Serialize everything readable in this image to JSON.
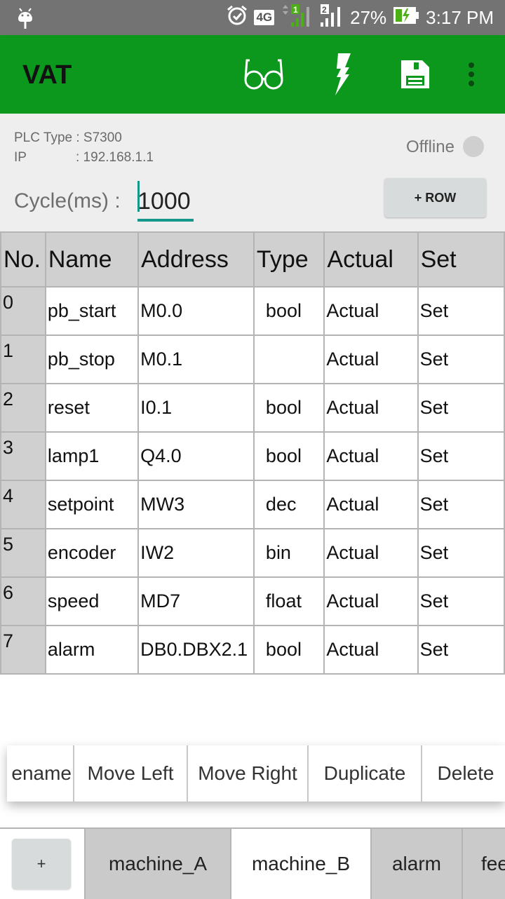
{
  "status_bar": {
    "network": "4G",
    "sim1": "1",
    "sim2": "2",
    "battery": "27%",
    "time": "3:17 PM"
  },
  "app_bar": {
    "title": "VAT",
    "actions": [
      "glasses-icon",
      "flash-icon",
      "save-icon",
      "overflow-menu-icon"
    ]
  },
  "info": {
    "plc_type_label": "PLC Type : S7300",
    "ip_label": "IP",
    "ip_value": ": 192.168.1.1",
    "status": "Offline",
    "cycle_label": "Cycle(ms) :",
    "cycle_value": "1000",
    "add_row_label": "+ ROW"
  },
  "table": {
    "headers": [
      "No.",
      "Name",
      "Address",
      "Type",
      "Actual",
      "Set"
    ],
    "rows": [
      {
        "no": "0",
        "name": "pb_start",
        "address": "M0.0",
        "type": "bool",
        "actual": "Actual",
        "set": "Set"
      },
      {
        "no": "1",
        "name": "pb_stop",
        "address": "M0.1",
        "type": "",
        "actual": "Actual",
        "set": "Set"
      },
      {
        "no": "2",
        "name": "reset",
        "address": "I0.1",
        "type": "bool",
        "actual": "Actual",
        "set": "Set"
      },
      {
        "no": "3",
        "name": "lamp1",
        "address": "Q4.0",
        "type": "bool",
        "actual": "Actual",
        "set": "Set"
      },
      {
        "no": "4",
        "name": "setpoint",
        "address": "MW3",
        "type": "dec",
        "actual": "Actual",
        "set": "Set"
      },
      {
        "no": "5",
        "name": "encoder",
        "address": "IW2",
        "type": "bin",
        "actual": "Actual",
        "set": "Set"
      },
      {
        "no": "6",
        "name": "speed",
        "address": "MD7",
        "type": "float",
        "actual": "Actual",
        "set": "Set"
      },
      {
        "no": "7",
        "name": "alarm",
        "address": "DB0.DBX2.1",
        "type": "bool",
        "actual": "Actual",
        "set": "Set"
      }
    ]
  },
  "context_menu": {
    "items": [
      "ename",
      "Move Left",
      "Move Right",
      "Duplicate",
      "Delete"
    ]
  },
  "tabs": {
    "add_label": "+",
    "items": [
      {
        "label": "machine_A",
        "active": false
      },
      {
        "label": "machine_B",
        "active": true
      },
      {
        "label": "alarm",
        "active": false
      },
      {
        "label": "fee",
        "active": false
      }
    ]
  }
}
